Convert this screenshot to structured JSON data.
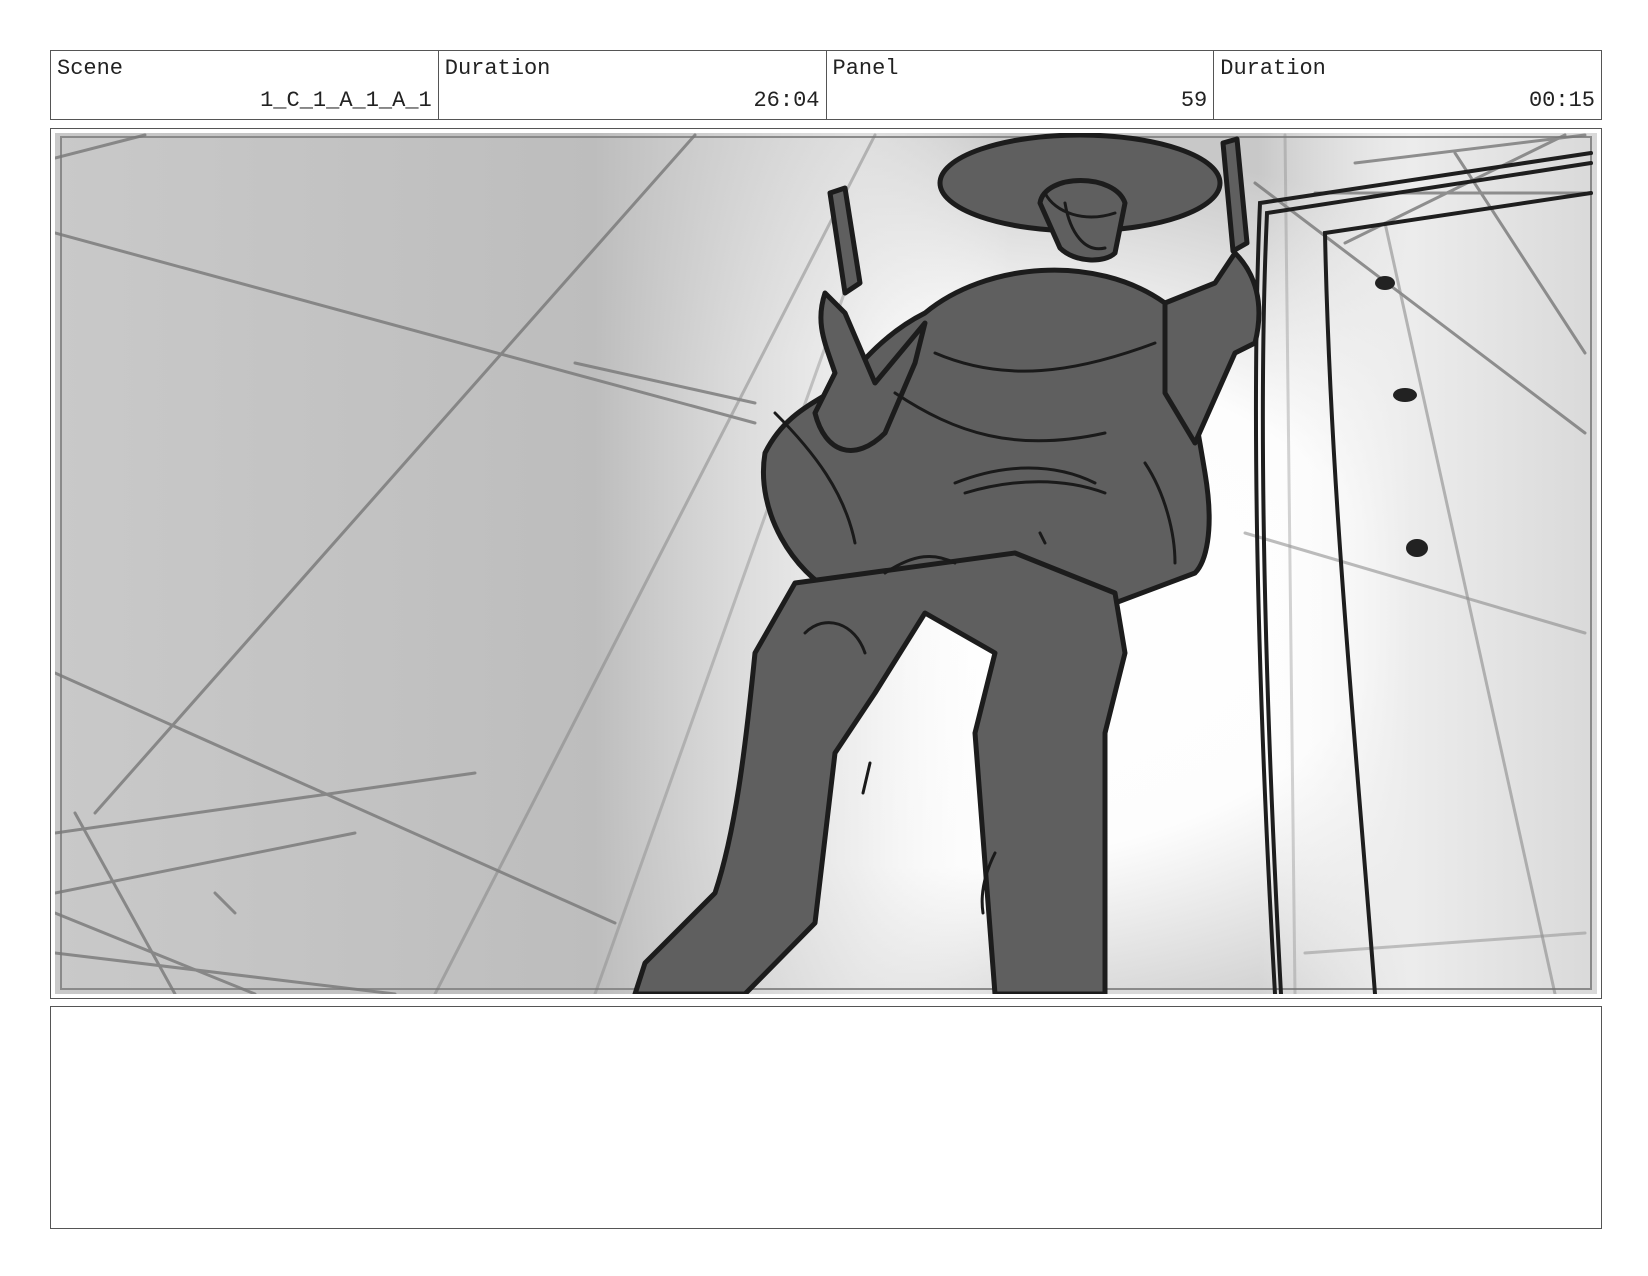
{
  "header": {
    "scene_label": "Scene",
    "scene_value": "1_C_1_A_1_A_1",
    "duration_label": "Duration",
    "duration_value": "26:04",
    "panel_label": "Panel",
    "panel_value": "59",
    "panel_duration_label": "Duration",
    "panel_duration_value": "00:15"
  },
  "notes": {
    "text": ""
  }
}
